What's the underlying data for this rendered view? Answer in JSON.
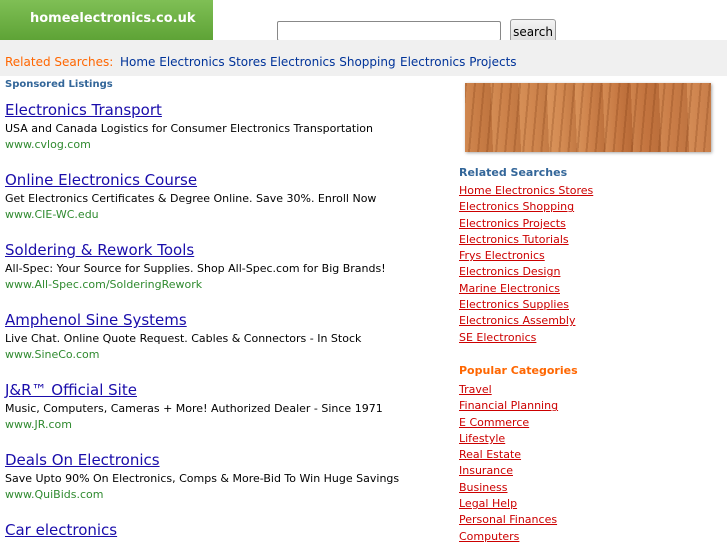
{
  "header": {
    "logo_text": "homeelectronics.co.uk",
    "search_placeholder": "",
    "search_button": "search"
  },
  "related_bar": {
    "label": "Related Searches:",
    "links": [
      "Home Electronics Stores",
      "Electronics Shopping",
      "Electronics Projects"
    ]
  },
  "sponsored_label": "Sponsored Listings",
  "listings": [
    {
      "title": "Electronics Transport",
      "desc": "USA and Canada Logistics for Consumer Electronics Transportation",
      "url": "www.cvlog.com"
    },
    {
      "title": "Online Electronics Course",
      "desc": "Get Electronics Certificates & Degree Online. Save 30%. Enroll Now",
      "url": "www.CIE-WC.edu"
    },
    {
      "title": "Soldering & Rework Tools",
      "desc": "All-Spec: Your Source for Supplies. Shop All-Spec.com for Big Brands!",
      "url": "www.All-Spec.com/SolderingRework"
    },
    {
      "title": "Amphenol Sine Systems",
      "desc": "Live Chat. Online Quote Request. Cables & Connectors - In Stock",
      "url": "www.SineCo.com"
    },
    {
      "title": "J&R™ Official Site",
      "desc": "Music, Computers, Cameras + More! Authorized Dealer - Since 1971",
      "url": "www.JR.com"
    },
    {
      "title": "Deals On Electronics",
      "desc": "Save Upto 90% On Electronics, Comps & More-Bid To Win Huge Savings",
      "url": "www.QuiBids.com"
    },
    {
      "title": "Car electronics",
      "desc": "",
      "url": ""
    }
  ],
  "sidebar": {
    "related_heading": "Related Searches",
    "related_links": [
      "Home Electronics Stores",
      "Electronics Shopping",
      "Electronics Projects",
      "Electronics Tutorials",
      "Frys Electronics",
      "Electronics Design",
      "Marine Electronics",
      "Electronics Supplies",
      "Electronics Assembly",
      "SE Electronics"
    ],
    "popular_heading": "Popular Categories",
    "popular_links": [
      "Travel",
      "Financial Planning",
      "E Commerce",
      "Lifestyle",
      "Real Estate",
      "Insurance",
      "Business",
      "Legal Help",
      "Personal Finances",
      "Computers"
    ]
  }
}
